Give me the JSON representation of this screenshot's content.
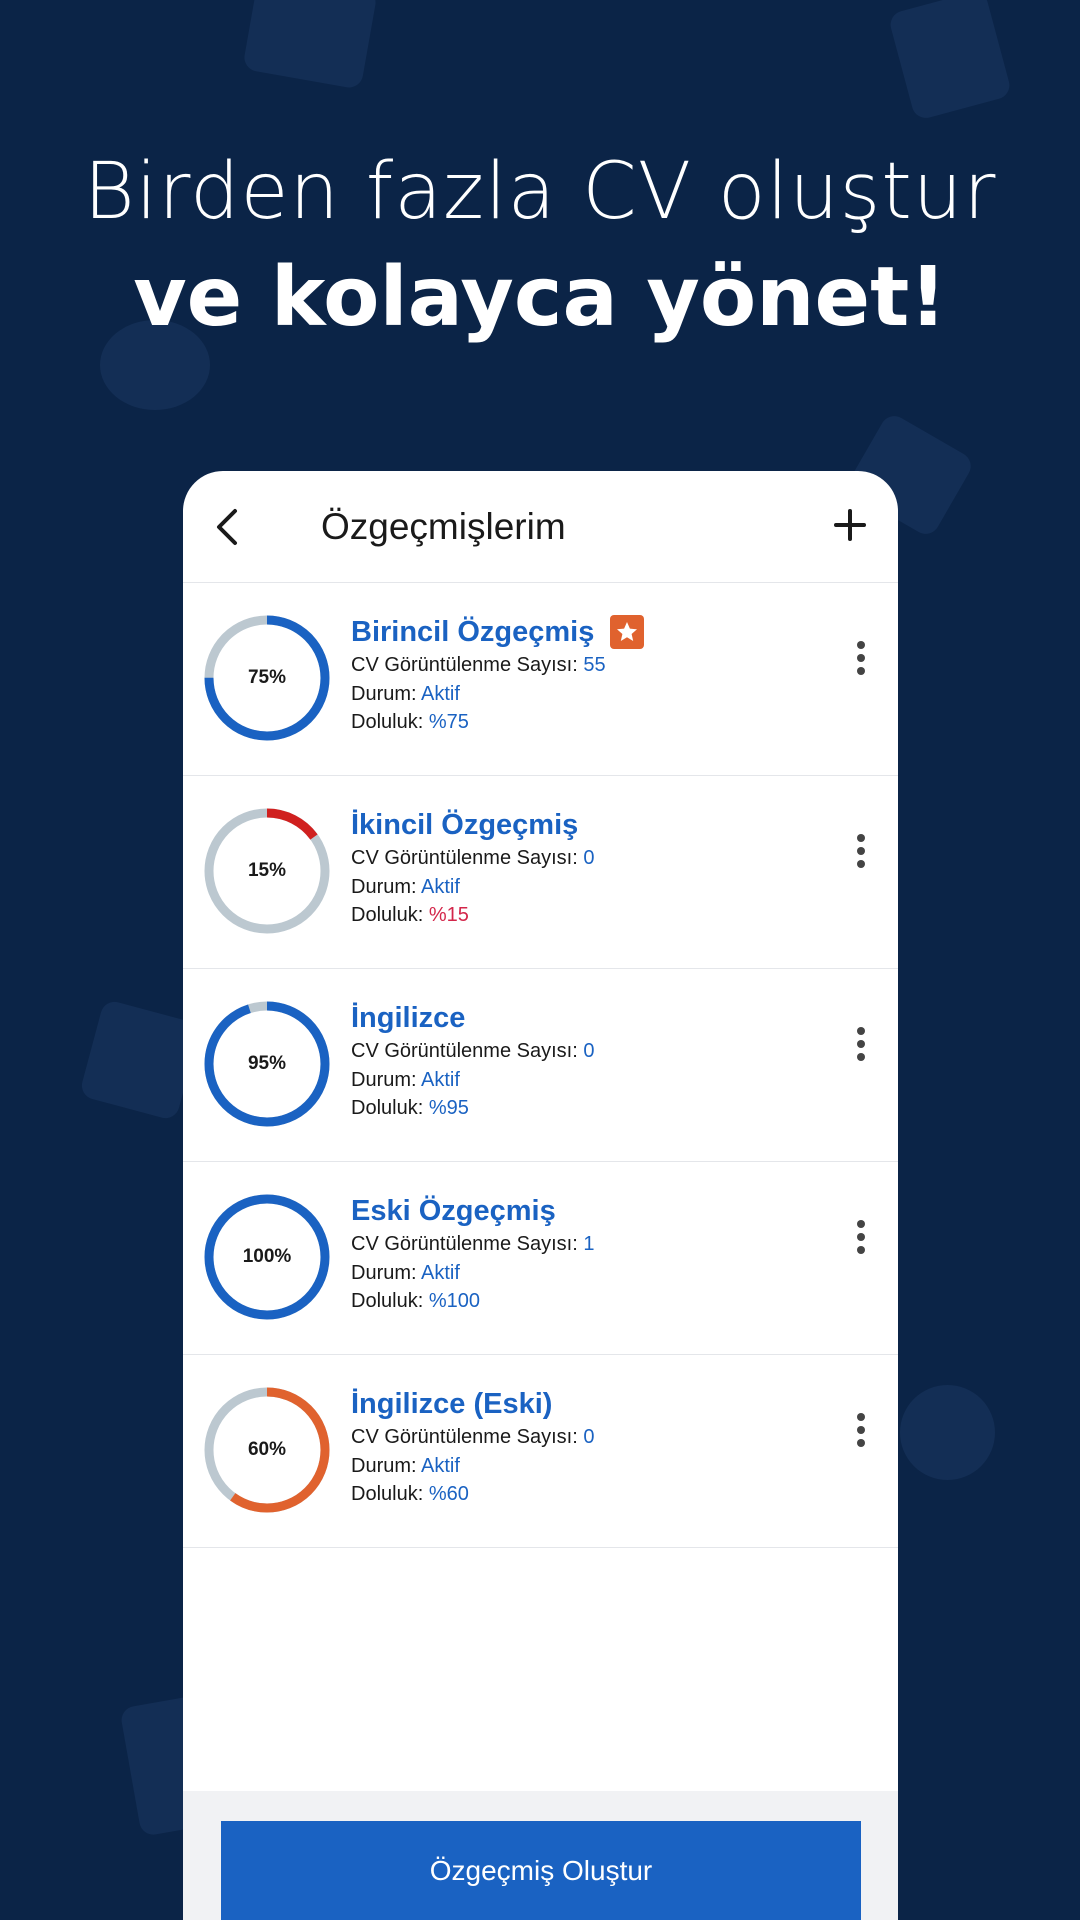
{
  "headline": {
    "line1": "Birden fazla CV oluştur",
    "line2": "ve kolayca yönet!"
  },
  "appbar": {
    "title": "Özgeçmişlerim",
    "back_icon": "chevron-left-icon",
    "add_icon": "plus-icon"
  },
  "labels": {
    "views": "CV Görüntülenme Sayısı: ",
    "status": "Durum: ",
    "fill": "Doluluk: "
  },
  "cv_list": [
    {
      "title": "Birincil Özgeçmiş",
      "primary": true,
      "ring_text": "75%",
      "progress": 0.75,
      "ring_color": "#1a62c2",
      "views": "55",
      "status": "Aktif",
      "fill": "%75"
    },
    {
      "title": "İkincil Özgeçmiş",
      "primary": false,
      "ring_text": "15%",
      "progress": 0.15,
      "ring_color": "#d0201f",
      "views": "0",
      "status": "Aktif",
      "fill": "%15"
    },
    {
      "title": "İngilizce",
      "primary": false,
      "ring_text": "95%",
      "progress": 0.95,
      "ring_color": "#1a62c2",
      "views": "0",
      "status": "Aktif",
      "fill": "%95"
    },
    {
      "title": "Eski Özgeçmiş",
      "primary": false,
      "ring_text": "100%",
      "progress": 1.0,
      "ring_color": "#1a62c2",
      "views": "1",
      "status": "Aktif",
      "fill": "%100"
    },
    {
      "title": "İngilizce (Eski)",
      "primary": false,
      "ring_text": "60%",
      "progress": 0.6,
      "ring_color": "#e0622e",
      "views": "0",
      "status": "Aktif",
      "fill": "%60"
    }
  ],
  "footer": {
    "create_label": "Özgeçmiş Oluştur"
  },
  "colors": {
    "background": "#0b2447",
    "accent": "#1a62c2",
    "ring_track": "#bcc8d0",
    "low_value": "#d3264a",
    "primary_badge": "#e0622e"
  }
}
